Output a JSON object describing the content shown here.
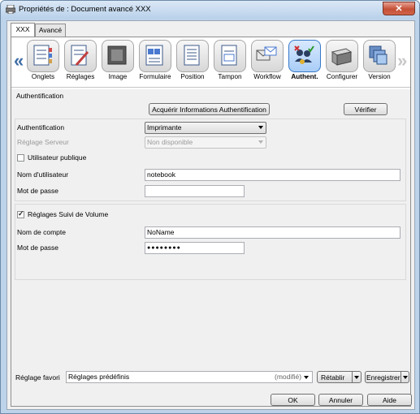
{
  "window": {
    "title": "Propriétés de : Document avancé XXX",
    "close_label": "✕"
  },
  "tabs": [
    {
      "label": "XXX"
    },
    {
      "label": "Avancé"
    }
  ],
  "nav": {
    "prev": "«",
    "next": "»"
  },
  "toolbar": [
    {
      "label": "Onglets",
      "icon": "tabs-icon"
    },
    {
      "label": "Réglages",
      "icon": "settings-icon"
    },
    {
      "label": "Image",
      "icon": "image-icon"
    },
    {
      "label": "Formulaire",
      "icon": "form-icon"
    },
    {
      "label": "Position",
      "icon": "position-icon"
    },
    {
      "label": "Tampon",
      "icon": "stamp-icon"
    },
    {
      "label": "Workflow",
      "icon": "workflow-icon"
    },
    {
      "label": "Authent.",
      "icon": "authentication-icon",
      "selected": true
    },
    {
      "label": "Configurer",
      "icon": "printer-icon"
    },
    {
      "label": "Version",
      "icon": "version-icon"
    }
  ],
  "auth": {
    "section_title": "Authentification",
    "acquire_button": "Acquérir Informations Authentification",
    "verify_button": "Vérifier",
    "authentication_label": "Authentification",
    "authentication_value": "Imprimante",
    "server_label": "Réglage Serveur",
    "server_value": "Non disponible",
    "public_user_label": "Utilisateur publique",
    "public_user_checked": false,
    "username_label": "Nom d'utilisateur",
    "username_value": "notebook",
    "password_label": "Mot de passe",
    "password_value": ""
  },
  "volume": {
    "checkbox_label": "Réglages Suivi de Volume",
    "checked": true,
    "account_label": "Nom de compte",
    "account_value": "NoName",
    "password_label": "Mot de passe",
    "password_value": "●●●●●●●●"
  },
  "footer": {
    "favorite_label": "Réglage favori",
    "favorite_value": "Réglages prédéfinis",
    "modified": "(modifié)",
    "restore_button": "Rétablir",
    "save_button": "Enregistrer",
    "ok_button": "OK",
    "cancel_button": "Annuler",
    "help_button": "Aide"
  },
  "colors": {
    "accent": "#3779c8",
    "title_bar": "#bcd3ea",
    "close": "#c45036"
  }
}
